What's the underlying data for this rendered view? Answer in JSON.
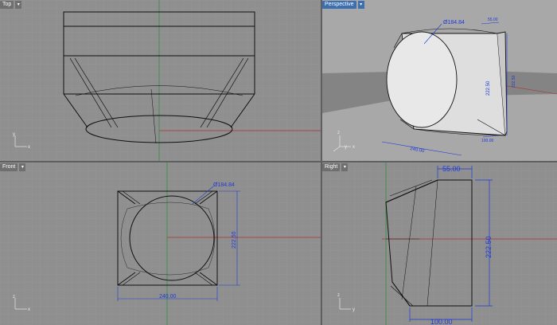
{
  "viewports": {
    "top": {
      "title": "Top",
      "axes": {
        "x": "x",
        "y": "y"
      }
    },
    "perspective": {
      "title": "Perspective",
      "dims": {
        "diameter": "Ø184.84",
        "width": "240.00",
        "height": "222.50",
        "depth_top": "55.00",
        "depth_side": "100.00",
        "right_height": "222.50"
      },
      "axes": {
        "x": "x",
        "y": "y",
        "z": "z"
      }
    },
    "front": {
      "title": "Front",
      "dims": {
        "diameter": "Ø184.84",
        "width": "240.00",
        "height": "222.50"
      },
      "axes": {
        "x": "x",
        "z": "z"
      }
    },
    "right": {
      "title": "Right",
      "dims": {
        "top": "55.00",
        "height": "222.50",
        "bottom": "100.00"
      },
      "axes": {
        "y": "y",
        "z": "z"
      }
    }
  },
  "colors": {
    "viewport_bg": "#8f8f8f",
    "active_bg": "#a8a8a8",
    "divider": "#5f5f5f",
    "dimension": "#1e3ad6",
    "x_axis": "#b03030",
    "y_axis": "#2f8f3f",
    "geometry": "#111111",
    "active_title": "#3c6fb0"
  }
}
